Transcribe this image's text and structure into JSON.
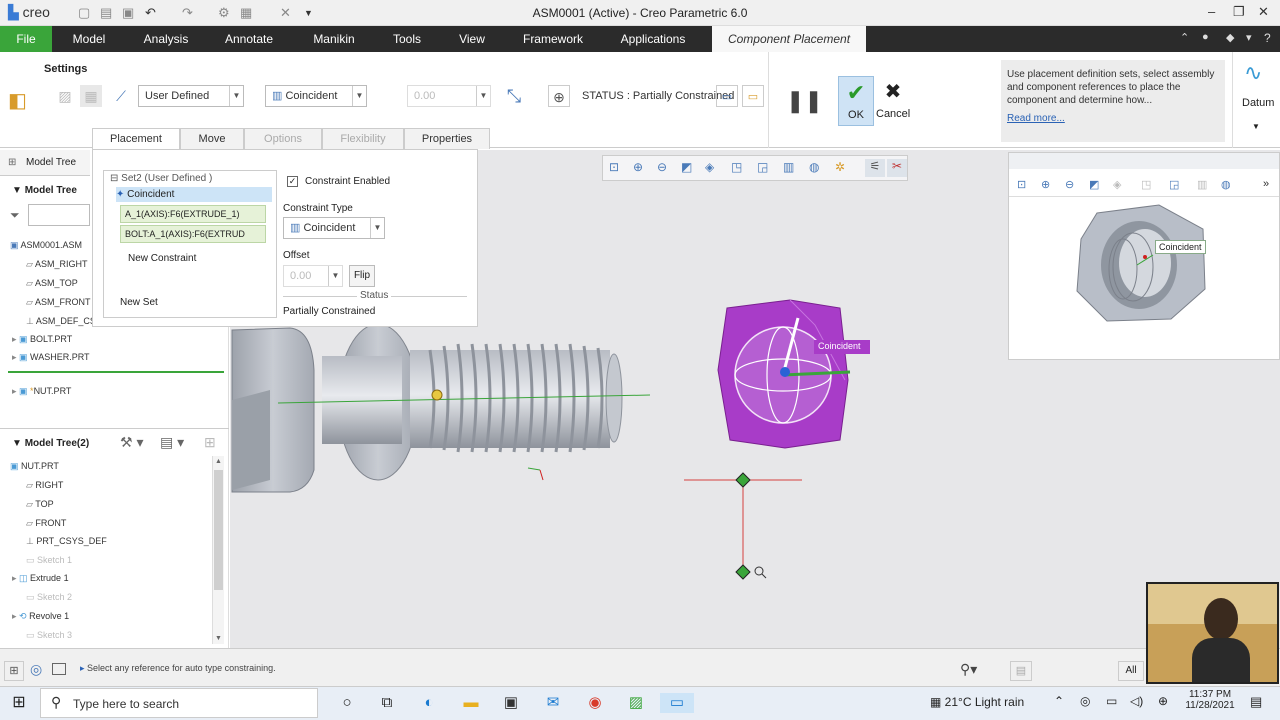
{
  "app": {
    "logo_text": "creo",
    "window_title": "ASM0001 (Active) - Creo Parametric 6.0"
  },
  "menu": {
    "file": "File",
    "items": [
      "Model",
      "Analysis",
      "Annotate",
      "Manikin",
      "Tools",
      "View",
      "Framework",
      "Applications"
    ],
    "active_tab": "Component Placement"
  },
  "ribbon": {
    "settings_label": "Settings",
    "set_type": "User Defined",
    "constraint": "Coincident",
    "offset_value": "0.00",
    "status_text": "STATUS : Partially Constrained",
    "ok_label": "OK",
    "cancel_label": "Cancel",
    "help_text": "Use placement definition sets, select assembly and component references to place the component and determine how...",
    "read_more": "Read more...",
    "datum_label": "Datum",
    "accent_color": "#3aa53a"
  },
  "subtabs": [
    {
      "label": "Placement",
      "enabled": true
    },
    {
      "label": "Move",
      "enabled": true
    },
    {
      "label": "Options",
      "enabled": false
    },
    {
      "label": "Flexibility",
      "enabled": false
    },
    {
      "label": "Properties",
      "enabled": true
    }
  ],
  "placement": {
    "set_label": "Set2 (User Defined )",
    "constraint_label": "Coincident",
    "ref1": "A_1(AXIS):F6(EXTRUDE_1)",
    "ref2": "BOLT:A_1(AXIS):F6(EXTRUD",
    "new_constraint": "New Constraint",
    "new_set": "New Set",
    "constraint_enabled": "Constraint Enabled",
    "constraint_type_label": "Constraint Type",
    "constraint_type_value": "Coincident",
    "offset_label": "Offset",
    "offset_value": "0.00",
    "flip": "Flip",
    "status_label": "Status",
    "status_value": "Partially Constrained"
  },
  "left_panel": {
    "tab_label": "Model Tree",
    "tree_title": "Model Tree",
    "items": [
      "ASM0001.ASM",
      "ASM_RIGHT",
      "ASM_TOP",
      "ASM_FRONT",
      "ASM_DEF_CS",
      "BOLT.PRT",
      "WASHER.PRT",
      "NUT.PRT"
    ],
    "tree2_title": "Model Tree(2)",
    "items2": [
      "NUT.PRT",
      "RIGHT",
      "TOP",
      "FRONT",
      "PRT_CSYS_DEF",
      "Sketch 1",
      "Extrude 1",
      "Sketch 2",
      "Revolve 1",
      "Sketch 3"
    ]
  },
  "viewport": {
    "coincident_tag": "Coincident",
    "mini_tag": "Coincident",
    "nut_color": "#a83cc8"
  },
  "statusbar": {
    "message": "Select any reference for auto type constraining.",
    "filter": "All"
  },
  "taskbar": {
    "search_placeholder": "Type here to search",
    "weather": "21°C  Light rain",
    "time": "11:37 PM",
    "date": "11/28/2021"
  }
}
